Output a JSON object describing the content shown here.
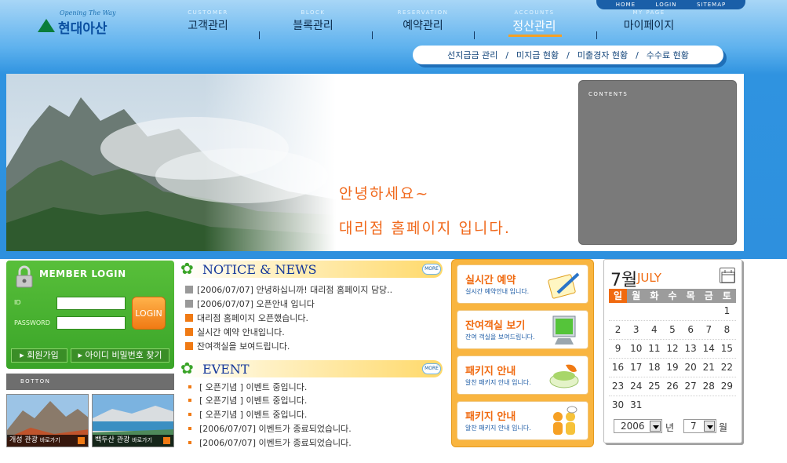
{
  "brand": {
    "tagline": "Opening The Way",
    "name": "현대아산"
  },
  "topbar": [
    "HOME",
    "LOGIN",
    "SITEMAP"
  ],
  "nav": [
    {
      "en": "CUSTOMER",
      "ko": "고객관리"
    },
    {
      "en": "BLOCK",
      "ko": "블록관리"
    },
    {
      "en": "RESERVATION",
      "ko": "예약관리"
    },
    {
      "en": "ACCOUNTS",
      "ko": "정산관리"
    },
    {
      "en": "MY PAGE",
      "ko": "마이페이지"
    }
  ],
  "nav_sep": "l",
  "subnav": [
    "선지급금 관리",
    "미지급 현황",
    "미출경자 현황",
    "수수료 현황"
  ],
  "subnav_sep": "/",
  "banner": {
    "line1": "안녕하세요~",
    "line2": "대리점 홈페이지 입니다.",
    "contents_label": "CONTENTS"
  },
  "member": {
    "title": "MEMBER  LOGIN",
    "id_label": "ID",
    "pw_label": "PASSWORD",
    "login": "LOGIN",
    "join": "회원가입",
    "find": "아이디 비밀번호 찾기"
  },
  "bottom_label": "BOTTON",
  "thumbs": [
    {
      "label": "개성 관광",
      "sub": "바로가기"
    },
    {
      "label": "백두산 관광",
      "sub": "바로가기"
    }
  ],
  "notice": {
    "title": "NOTICE & NEWS",
    "more": "MORE",
    "items": [
      "[2006/07/07] 안녕하십니까! 대리점 홈페이지 담당..",
      "[2006/07/07] 오픈안내 입니다",
      "대리점 홈페이지 오픈했습니다.",
      "실시간 예약 안내입니다.",
      "잔여객실을 보여드립니다."
    ]
  },
  "event": {
    "title": "EVENT",
    "more": "MORE",
    "items": [
      "[ 오픈기념 ] 이벤트 중입니다.",
      "[ 오픈기념 ] 이벤트 중입니다.",
      "[ 오픈기념 ] 이벤트 중입니다.",
      "[2006/07/07] 이벤트가 종료되었습니다.",
      "[2006/07/07] 이벤트가 종료되었습니다."
    ]
  },
  "cards": [
    {
      "title": "실시간 예약",
      "sub": "실시간 예약안내 입니다."
    },
    {
      "title": "잔여객실 보기",
      "sub": "잔여 객실을 보여드립니다."
    },
    {
      "title": "패키지 안내",
      "sub": "알찬 패키지 안내 입니다."
    },
    {
      "title": "패키지 안내",
      "sub": "알찬 패키지 안내 입니다."
    }
  ],
  "calendar": {
    "month_num": "7",
    "month_kr": "월",
    "month_en": "JULY",
    "dow": [
      "일",
      "월",
      "화",
      "수",
      "목",
      "금",
      "토"
    ],
    "weeks": [
      [
        "",
        "",
        "",
        "",
        "",
        "",
        "1"
      ],
      [
        "2",
        "3",
        "4",
        "5",
        "6",
        "7",
        "8"
      ],
      [
        "9",
        "10",
        "11",
        "12",
        "13",
        "14",
        "15"
      ],
      [
        "16",
        "17",
        "18",
        "19",
        "20",
        "21",
        "22"
      ],
      [
        "23",
        "24",
        "25",
        "26",
        "27",
        "28",
        "29"
      ],
      [
        "30",
        "31",
        "",
        "",
        "",
        "",
        ""
      ]
    ],
    "year": "2006",
    "year_label": "년",
    "month": "7",
    "month_label": "월"
  },
  "colors": {
    "sky": "#2f93e0",
    "orange": "#f06a10",
    "green": "#3aa428",
    "gray": "#7a7a7a"
  }
}
